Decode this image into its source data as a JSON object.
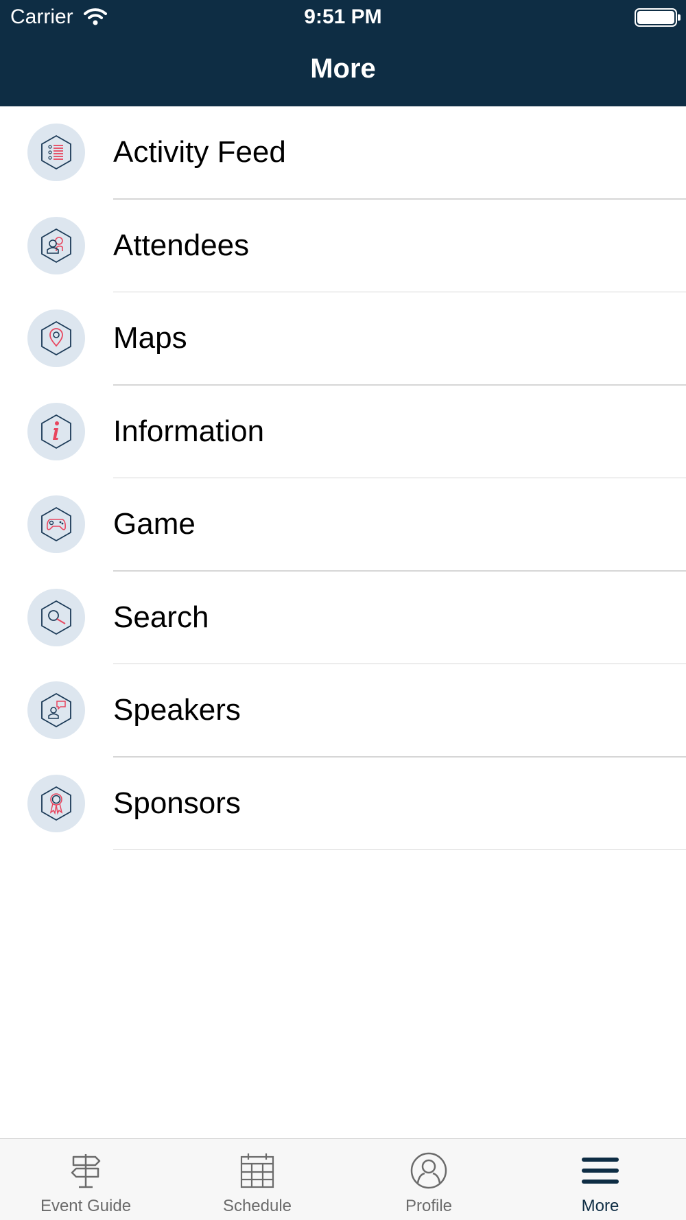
{
  "status_bar": {
    "carrier": "Carrier",
    "time": "9:51 PM"
  },
  "nav": {
    "title": "More"
  },
  "menu": [
    {
      "label": "Activity Feed",
      "icon": "activity-feed-icon"
    },
    {
      "label": "Attendees",
      "icon": "attendees-icon"
    },
    {
      "label": "Maps",
      "icon": "map-pin-icon"
    },
    {
      "label": "Information",
      "icon": "info-icon"
    },
    {
      "label": "Game",
      "icon": "game-controller-icon"
    },
    {
      "label": "Search",
      "icon": "search-icon"
    },
    {
      "label": "Speakers",
      "icon": "speaker-icon"
    },
    {
      "label": "Sponsors",
      "icon": "award-ribbon-icon"
    }
  ],
  "tabs": [
    {
      "label": "Event Guide",
      "icon": "signpost-icon"
    },
    {
      "label": "Schedule",
      "icon": "calendar-icon"
    },
    {
      "label": "Profile",
      "icon": "user-circle-icon"
    },
    {
      "label": "More",
      "icon": "hamburger-menu-icon",
      "active": true
    }
  ],
  "colors": {
    "header_bg": "#0e2d44",
    "icon_circle": "#dde6ef",
    "accent": "#e8455e",
    "icon_stroke": "#1b3a57"
  }
}
